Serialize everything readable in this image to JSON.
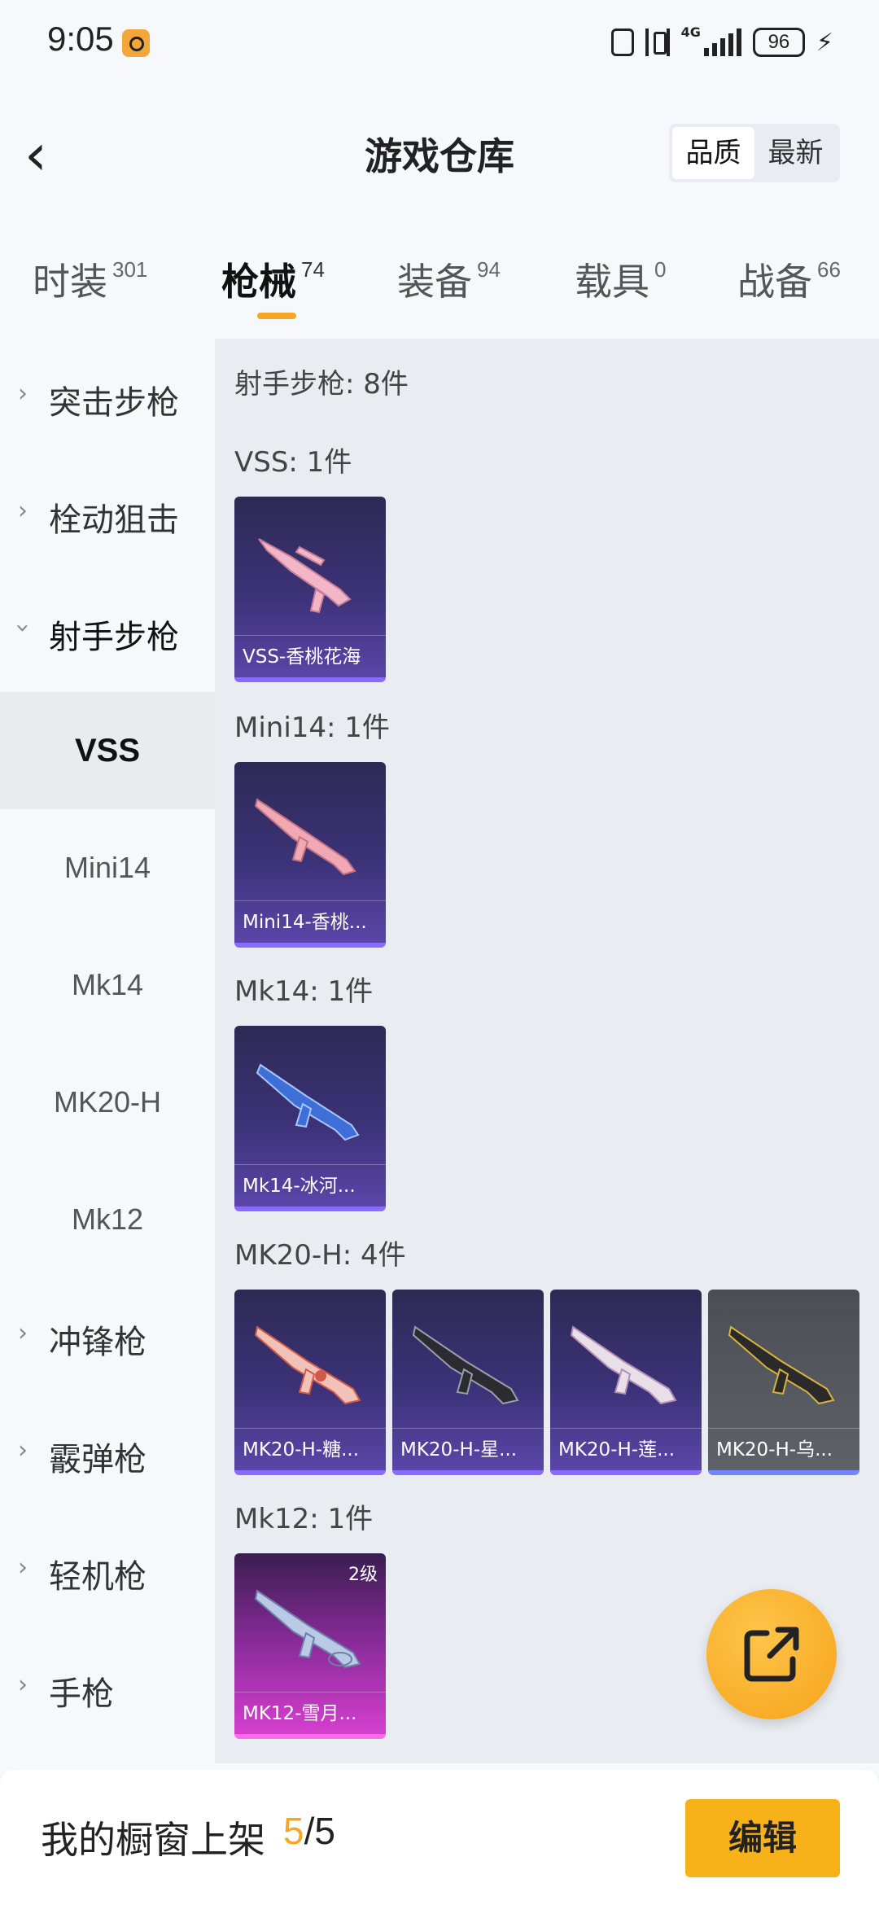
{
  "status_bar": {
    "time": "9:05",
    "network": "4G",
    "battery": "96"
  },
  "header": {
    "title": "游戏仓库",
    "sort_options": [
      "品质",
      "最新"
    ],
    "sort_selected": "品质"
  },
  "tabs": [
    {
      "label": "时装",
      "count": "301"
    },
    {
      "label": "枪械",
      "count": "74",
      "active": true
    },
    {
      "label": "装备",
      "count": "94"
    },
    {
      "label": "载具",
      "count": "0"
    },
    {
      "label": "战备",
      "count": "66"
    }
  ],
  "sidebar": {
    "categories": [
      "突击步枪",
      "栓动狙击",
      "射手步枪",
      "冲锋枪",
      "霰弹枪",
      "轻机枪",
      "手枪"
    ],
    "subcategories": [
      "VSS",
      "Mini14",
      "Mk14",
      "MK20-H",
      "Mk12"
    ],
    "selected": "VSS"
  },
  "content": {
    "header": "射手步枪: 8件",
    "sections": [
      {
        "heading": "VSS: 1件",
        "items": [
          {
            "name": "VSS-香桃花海",
            "rarity": "purple"
          }
        ]
      },
      {
        "heading": "Mini14: 1件",
        "items": [
          {
            "name": "Mini14-香桃...",
            "rarity": "purple"
          }
        ]
      },
      {
        "heading": "Mk14: 1件",
        "items": [
          {
            "name": "Mk14-冰河...",
            "rarity": "purple"
          }
        ]
      },
      {
        "heading": "MK20-H: 4件",
        "items": [
          {
            "name": "MK20-H-糖...",
            "rarity": "purple"
          },
          {
            "name": "MK20-H-星...",
            "rarity": "purple"
          },
          {
            "name": "MK20-H-莲...",
            "rarity": "purple"
          },
          {
            "name": "MK20-H-乌...",
            "rarity": "gray"
          }
        ]
      },
      {
        "heading": "Mk12: 1件",
        "items": [
          {
            "name": "MK12-雪月...",
            "rarity": "pink",
            "level": "2级"
          }
        ]
      }
    ]
  },
  "bottom_bar": {
    "label": "我的橱窗上架",
    "current": "5",
    "separator": "/",
    "total": "5",
    "edit_label": "编辑"
  },
  "colors": {
    "accent": "#f5a623",
    "edit_button": "#f7b21a",
    "purple_rarity": "#8a6bff",
    "pink_rarity": "#d53fcf"
  }
}
